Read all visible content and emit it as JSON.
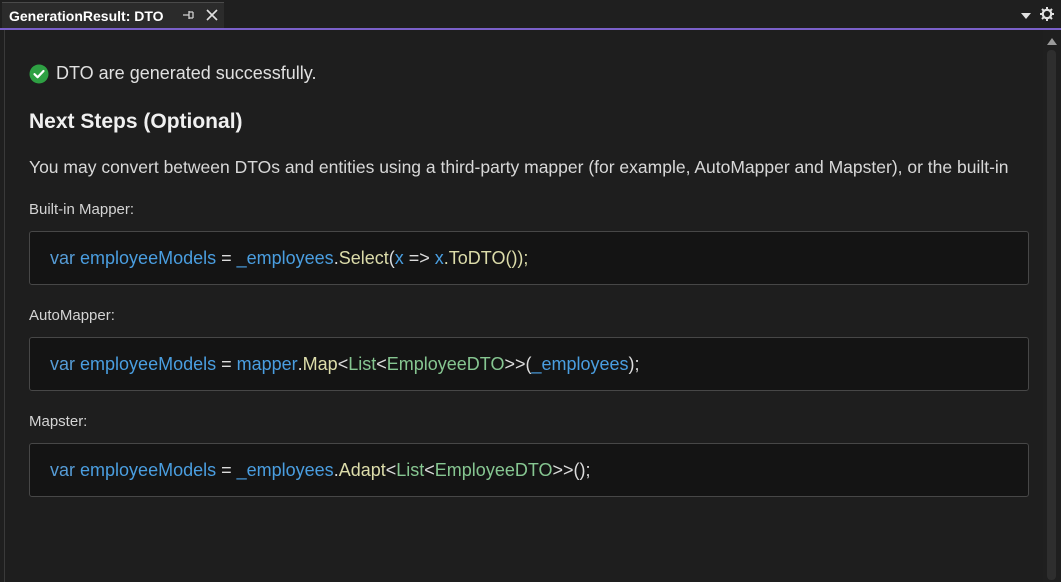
{
  "tab": {
    "title": "GenerationResult: DTO"
  },
  "icons": {
    "pin": "pin-icon",
    "close": "close-icon",
    "dropdown": "chevron-down-icon",
    "settings": "gear-icon",
    "success": "check-circle-icon"
  },
  "colors": {
    "accent": "#7a60c9",
    "success": "#2ea043",
    "keyword": "#569cd6",
    "identifier": "#4a9ee0",
    "method": "#dcdcaa",
    "type": "#4ec9b0"
  },
  "content": {
    "status": "DTO are generated successfully.",
    "heading": "Next Steps (Optional)",
    "description": "You may convert between DTOs and entities using a third-party mapper (for example, AutoMapper and Mapster), or the built-in"
  },
  "sections": {
    "builtin": {
      "label": "Built-in Mapper:",
      "code": [
        "var",
        " ",
        "employeeModels",
        " = ",
        "_employees",
        ".",
        "Select",
        "(",
        "x",
        " => ",
        "x",
        ".ToDTO());"
      ]
    },
    "automapper": {
      "label": "AutoMapper:",
      "code": [
        "var",
        " ",
        "employeeModels",
        " = ",
        "mapper",
        ".",
        "Map",
        "<",
        "List",
        "<",
        "EmployeeDTO",
        ">>(",
        "_employees",
        ");"
      ]
    },
    "mapster": {
      "label": "Mapster:",
      "code": [
        "var",
        " ",
        "employeeModels",
        " = ",
        "_employees",
        ".",
        "Adapt",
        "<",
        "List",
        "<",
        "EmployeeDTO",
        ">>();"
      ]
    }
  }
}
